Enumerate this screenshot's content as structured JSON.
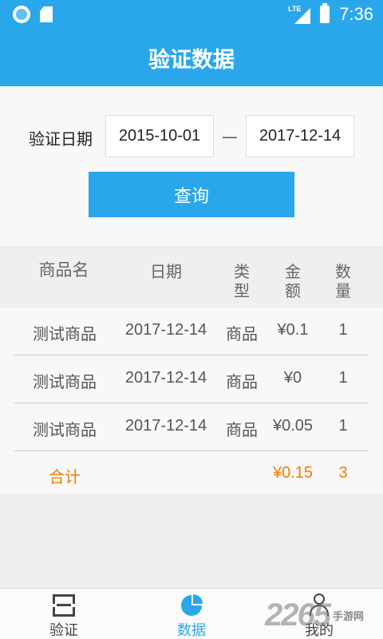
{
  "status_bar": {
    "network": "LTE",
    "time": "7:36"
  },
  "header": {
    "title": "验证数据"
  },
  "filter": {
    "label": "验证日期",
    "start_date": "2015-10-01",
    "separator": "—",
    "end_date": "2017-12-14",
    "query_button": "查询"
  },
  "table": {
    "columns": {
      "name": "商品名",
      "date": "日期",
      "type": "类型",
      "amount": "金额",
      "qty": "数量"
    },
    "rows": [
      {
        "name": "测试商品",
        "date": "2017-12-14",
        "type": "商品",
        "amount": "¥0.1",
        "qty": "1"
      },
      {
        "name": "测试商品",
        "date": "2017-12-14",
        "type": "商品",
        "amount": "¥0",
        "qty": "1"
      },
      {
        "name": "测试商品",
        "date": "2017-12-14",
        "type": "商品",
        "amount": "¥0.05",
        "qty": "1"
      }
    ],
    "total": {
      "label": "合计",
      "amount": "¥0.15",
      "qty": "3"
    }
  },
  "bottom_nav": {
    "items": [
      {
        "label": "验证",
        "icon": "scan-icon"
      },
      {
        "label": "数据",
        "icon": "pie-chart-icon",
        "active": true
      },
      {
        "label": "我的",
        "icon": "user-icon"
      }
    ]
  },
  "watermark": {
    "number": "2265",
    "text": "手游网"
  },
  "colors": {
    "primary": "#2aa7ea",
    "total": "#f07d00"
  }
}
